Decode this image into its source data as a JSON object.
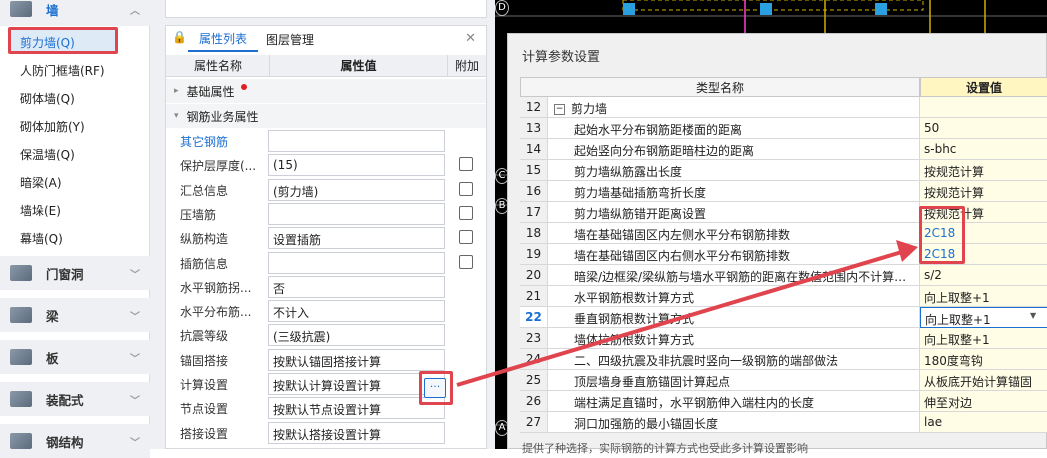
{
  "left_panel": {
    "wall_category": "墙",
    "items": [
      "剪力墙(Q)",
      "人防门框墙(RF)",
      "砌体墙(Q)",
      "砌体加筋(Y)",
      "保温墙(Q)",
      "暗梁(A)",
      "墙垛(E)",
      "幕墙(Q)"
    ],
    "categories": [
      "门窗洞",
      "梁",
      "板",
      "装配式",
      "钢结构"
    ]
  },
  "props": {
    "tabs": [
      "属性列表",
      "图层管理"
    ],
    "headers": {
      "name": "属性名称",
      "value": "属性值",
      "extra": "附加"
    },
    "groups": [
      "基础属性",
      "钢筋业务属性"
    ],
    "rows": [
      {
        "label": "其它钢筋",
        "value": "",
        "check": false
      },
      {
        "label": "保护层厚度(...",
        "value": "(15)",
        "check": true
      },
      {
        "label": "汇总信息",
        "value": "(剪力墙)",
        "check": true
      },
      {
        "label": "压墙筋",
        "value": "",
        "check": true
      },
      {
        "label": "纵筋构造",
        "value": "设置插筋",
        "check": true
      },
      {
        "label": "插筋信息",
        "value": "",
        "check": true
      },
      {
        "label": "水平钢筋拐...",
        "value": "否",
        "check": false
      },
      {
        "label": "水平分布筋...",
        "value": "不计入",
        "check": false
      },
      {
        "label": "抗震等级",
        "value": "(三级抗震)",
        "check": false
      },
      {
        "label": "锚固搭接",
        "value": "按默认锚固搭接计算",
        "check": false
      },
      {
        "label": "计算设置",
        "value": "按默认计算设置计算",
        "check": false
      },
      {
        "label": "节点设置",
        "value": "按默认节点设置计算",
        "check": false
      },
      {
        "label": "搭接设置",
        "value": "按默认搭接设置计算",
        "check": false
      }
    ],
    "ellipsis": "···"
  },
  "cad": {
    "axis_labels": [
      "D",
      "C",
      "B",
      "A"
    ]
  },
  "dialog": {
    "title": "计算参数设置",
    "col_name": "类型名称",
    "col_value": "设置值",
    "rows": [
      {
        "n": "12",
        "name": "剪力墙",
        "value": "",
        "group": true
      },
      {
        "n": "13",
        "name": "起始水平分布钢筋距楼面的距离",
        "value": "50"
      },
      {
        "n": "14",
        "name": "起始竖向分布钢筋距暗柱边的距离",
        "value": "s-bhc"
      },
      {
        "n": "15",
        "name": "剪力墙纵筋露出长度",
        "value": "按规范计算"
      },
      {
        "n": "16",
        "name": "剪力墙基础插筋弯折长度",
        "value": "按规范计算"
      },
      {
        "n": "17",
        "name": "剪力墙纵筋错开距离设置",
        "value": "按规范计算"
      },
      {
        "n": "18",
        "name": "墙在基础锚固区内左侧水平分布钢筋排数",
        "value": "2C18",
        "blue": true
      },
      {
        "n": "19",
        "name": "墙在基础锚固区内右侧水平分布钢筋排数",
        "value": "2C18",
        "blue": true
      },
      {
        "n": "20",
        "name": "暗梁/边框梁/梁纵筋与墙水平钢筋的距离在数值范围内不计算…",
        "value": "s/2"
      },
      {
        "n": "21",
        "name": "水平钢筋根数计算方式",
        "value": "向上取整+1"
      },
      {
        "n": "22",
        "name": "垂直钢筋根数计算方式",
        "value": "向上取整+1",
        "selected": true
      },
      {
        "n": "23",
        "name": "墙体拉筋根数计算方式",
        "value": "向上取整+1"
      },
      {
        "n": "24",
        "name": "二、四级抗震及非抗震时竖向一级钢筋的端部做法",
        "value": "180度弯钩"
      },
      {
        "n": "25",
        "name": "顶层墙身垂直筋锚固计算起点",
        "value": "从板底开始计算锚固"
      },
      {
        "n": "26",
        "name": "端柱满足直锚时，水平钢筋伸入端柱内的长度",
        "value": "伸至对边"
      },
      {
        "n": "27",
        "name": "洞口加强筋的最小锚固长度",
        "value": "lae"
      }
    ],
    "footer": "提供了种选择，实际钢筋的计算方式也受此多计算设置影响"
  },
  "colors": {
    "accent": "#1b6fd1",
    "highlight": "#e0454f"
  }
}
